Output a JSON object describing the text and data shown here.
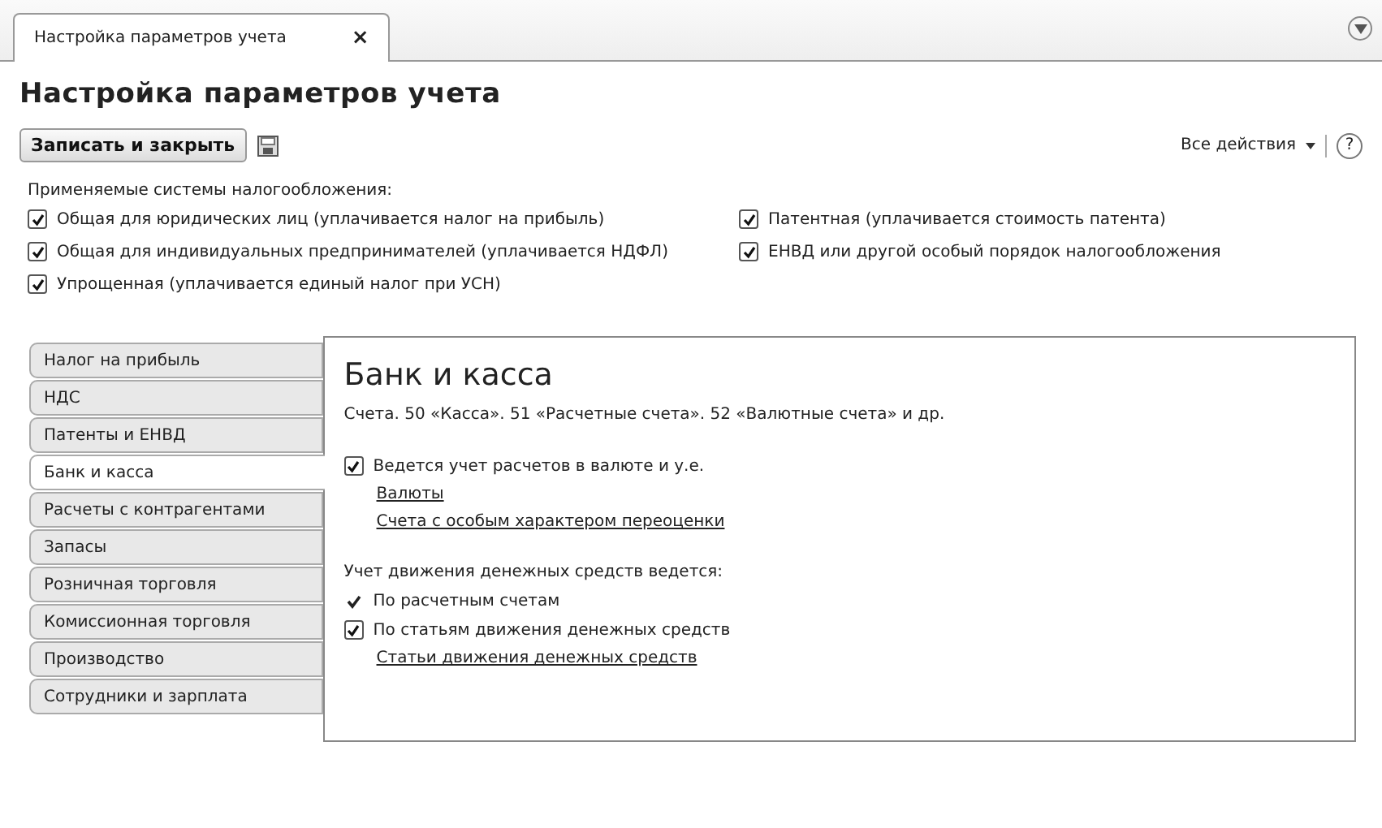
{
  "tabs": [
    {
      "label": "Настройка параметров учета",
      "close": "×",
      "selected": true
    }
  ],
  "title": "Настройка параметров учета",
  "toolbar": {
    "save_close": "Записать и закрыть",
    "all_actions": "Все действия",
    "help": "?"
  },
  "tax_systems": {
    "label": "Применяемые системы налогообложения:",
    "items": [
      {
        "label": "Общая для юридических лиц (уплачивается налог на прибыль)",
        "checked": true
      },
      {
        "label": "Патентная (уплачивается стоимость патента)",
        "checked": true
      },
      {
        "label": "Общая для индивидуальных предпринимателей (уплачивается НДФЛ)",
        "checked": true
      },
      {
        "label": "ЕНВД или другой особый порядок налогообложения",
        "checked": true
      },
      {
        "label": "Упрощенная (уплачивается единый налог при УСН)",
        "checked": true
      }
    ]
  },
  "sections": [
    {
      "label": "Налог на прибыль",
      "selected": false
    },
    {
      "label": "НДС",
      "selected": false
    },
    {
      "label": "Патенты и ЕНВД",
      "selected": false
    },
    {
      "label": "Банк и касса",
      "selected": true
    },
    {
      "label": "Расчеты с контрагентами",
      "selected": false
    },
    {
      "label": "Запасы",
      "selected": false
    },
    {
      "label": "Розничная торговля",
      "selected": false
    },
    {
      "label": "Комиссионная торговля",
      "selected": false
    },
    {
      "label": "Производство",
      "selected": false
    },
    {
      "label": "Сотрудники и зарплата",
      "selected": false
    }
  ],
  "panel": {
    "title": "Банк и касса",
    "items": [
      {
        "kind": "text",
        "label": "Счета. 50 «Касса». 51 «Расчетные счета». 52 «Валютные счета» и др."
      },
      {
        "kind": "gap"
      },
      {
        "kind": "checkbox",
        "label": "Ведется учет расчетов в валюте и у.е.",
        "checked": true
      },
      {
        "kind": "link",
        "label": "Валюты"
      },
      {
        "kind": "link",
        "label": "Счета с особым характером переоценки"
      },
      {
        "kind": "gap"
      },
      {
        "kind": "text",
        "label": "Учет движения денежных средств ведется:"
      },
      {
        "kind": "tick",
        "label": "По расчетным счетам",
        "checked": true
      },
      {
        "kind": "checkbox",
        "label": "По статьям движения денежных средств",
        "checked": true
      },
      {
        "kind": "link",
        "label": "Статьи движения денежных средств"
      }
    ]
  }
}
